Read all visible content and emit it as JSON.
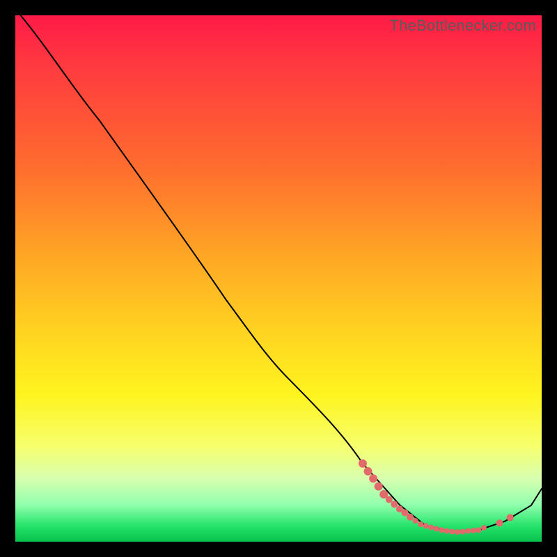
{
  "watermark": "TheBottlenecker.com",
  "chart_data": {
    "type": "line",
    "title": "",
    "xlabel": "",
    "ylabel": "",
    "xlim": [
      0,
      100
    ],
    "ylim": [
      0,
      100
    ],
    "background_gradient": {
      "direction": "vertical",
      "stops": [
        {
          "pos": 0,
          "color": "#ff1a47"
        },
        {
          "pos": 10,
          "color": "#ff3b3f"
        },
        {
          "pos": 28,
          "color": "#ff6a2f"
        },
        {
          "pos": 45,
          "color": "#ffa425"
        },
        {
          "pos": 60,
          "color": "#ffd321"
        },
        {
          "pos": 72,
          "color": "#fff41f"
        },
        {
          "pos": 82,
          "color": "#f6ff6e"
        },
        {
          "pos": 88,
          "color": "#d8ffb0"
        },
        {
          "pos": 93,
          "color": "#91ffad"
        },
        {
          "pos": 97,
          "color": "#25e36b"
        },
        {
          "pos": 100,
          "color": "#08c24e"
        }
      ]
    },
    "series": [
      {
        "name": "bottleneck-curve",
        "color": "#000000",
        "curve": [
          {
            "x": 1,
            "y": 100
          },
          {
            "x": 16,
            "y": 80
          },
          {
            "x": 40,
            "y": 46
          },
          {
            "x": 52,
            "y": 30.85
          },
          {
            "x": 66,
            "y": 14.85
          },
          {
            "x": 73,
            "y": 7.0
          },
          {
            "x": 78,
            "y": 3.0
          },
          {
            "x": 83,
            "y": 1.9
          },
          {
            "x": 88,
            "y": 2.2
          },
          {
            "x": 93,
            "y": 3.87
          },
          {
            "x": 98,
            "y": 6.9
          },
          {
            "x": 100,
            "y": 10.05
          }
        ]
      }
    ],
    "markers": {
      "name": "valley-points",
      "color": "#e26a6a",
      "points": [
        {
          "x": 66,
          "y": 14.85
        },
        {
          "x": 67,
          "y": 13.37
        },
        {
          "x": 68,
          "y": 12.0
        },
        {
          "x": 69,
          "y": 10.5
        },
        {
          "x": 70,
          "y": 9.0
        },
        {
          "x": 71,
          "y": 8.0
        },
        {
          "x": 72,
          "y": 7.12
        },
        {
          "x": 73,
          "y": 6.22
        },
        {
          "x": 74,
          "y": 5.5
        },
        {
          "x": 75,
          "y": 4.67
        },
        {
          "x": 76,
          "y": 3.97
        },
        {
          "x": 77,
          "y": 3.31
        },
        {
          "x": 78,
          "y": 3.0
        },
        {
          "x": 79,
          "y": 2.71
        },
        {
          "x": 80,
          "y": 2.46
        },
        {
          "x": 81,
          "y": 2.21
        },
        {
          "x": 82,
          "y": 2.04
        },
        {
          "x": 83,
          "y": 1.9
        },
        {
          "x": 84,
          "y": 1.85
        },
        {
          "x": 85,
          "y": 1.9
        },
        {
          "x": 86,
          "y": 2.04
        },
        {
          "x": 87,
          "y": 2.12
        },
        {
          "x": 88,
          "y": 2.2
        },
        {
          "x": 89,
          "y": 2.65
        },
        {
          "x": 92,
          "y": 3.53
        },
        {
          "x": 94,
          "y": 4.58
        }
      ]
    }
  }
}
